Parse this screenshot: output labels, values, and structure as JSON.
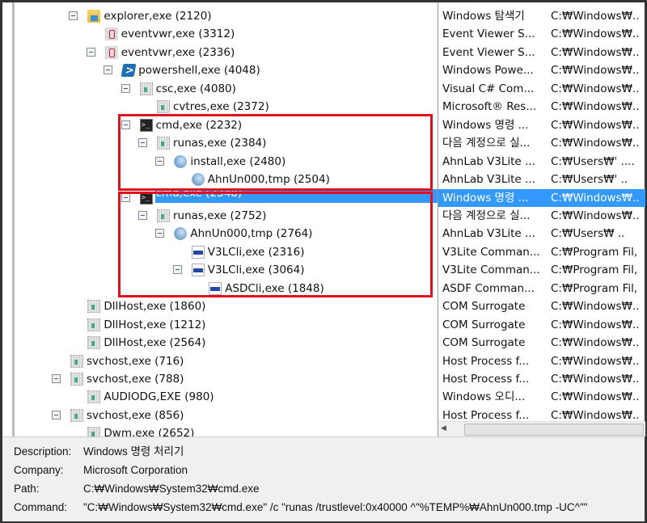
{
  "tree": [
    {
      "name": "explorer,exe (2120)",
      "depth": 1,
      "expand": true,
      "icon": "folder-icon",
      "desc": "Windows 탐색기",
      "path": "C:₩Windows₩.."
    },
    {
      "name": "eventvwr,exe (3312)",
      "depth": 2,
      "expand": false,
      "icon": "event-viewer-icon",
      "desc": "Event Viewer S...",
      "path": "C:₩Windows₩.."
    },
    {
      "name": "eventvwr,exe (2336)",
      "depth": 2,
      "expand": true,
      "icon": "event-viewer-icon",
      "desc": "Event Viewer S...",
      "path": "C:₩Windows₩.."
    },
    {
      "name": "powershell,exe (4048)",
      "depth": 3,
      "expand": true,
      "icon": "powershell-icon",
      "desc": "Windows Powe...",
      "path": "C:₩Windows₩.."
    },
    {
      "name": "csc,exe (4080)",
      "depth": 4,
      "expand": true,
      "icon": "generic-exe-icon",
      "desc": "Visual C# Com...",
      "path": "C:₩Windows₩.."
    },
    {
      "name": "cvtres,exe (2372)",
      "depth": 5,
      "expand": false,
      "icon": "generic-exe-icon",
      "desc": "Microsoft® Res...",
      "path": "C:₩Windows₩.."
    },
    {
      "name": "cmd,exe (2232)",
      "depth": 4,
      "expand": true,
      "icon": "cmd-icon",
      "desc": "Windows 명령 ...",
      "path": "C:₩Windows₩.."
    },
    {
      "name": "runas,exe (2384)",
      "depth": 5,
      "expand": true,
      "icon": "generic-exe-icon",
      "desc": "다음 계정으로 실...",
      "path": "C:₩Windows₩.."
    },
    {
      "name": "install,exe (2480)",
      "depth": 6,
      "expand": true,
      "icon": "installer-icon",
      "desc": "AhnLab V3Lite ...",
      "path": "C:₩Users₩'  ...."
    },
    {
      "name": "AhnUn000,tmp (2504)",
      "depth": 7,
      "expand": false,
      "icon": "installer-icon",
      "desc": "AhnLab V3Lite ...",
      "path": "C:₩Users₩'   .."
    },
    {
      "name": "cmd,exe (2348)",
      "depth": 4,
      "expand": true,
      "icon": "cmd-icon",
      "desc": "Windows 명령 ...",
      "path": "C:₩Windows₩..",
      "selected": true
    },
    {
      "name": "runas,exe (2752)",
      "depth": 5,
      "expand": true,
      "icon": "generic-exe-icon",
      "desc": "다음 계정으로 실...",
      "path": "C:₩Windows₩.."
    },
    {
      "name": "AhnUn000,tmp (2764)",
      "depth": 6,
      "expand": true,
      "icon": "installer-icon",
      "desc": "AhnLab V3Lite ...",
      "path": "C:₩Users₩    .."
    },
    {
      "name": "V3LCli,exe (2316)",
      "depth": 7,
      "expand": false,
      "icon": "v3-icon",
      "desc": "V3Lite Comman...",
      "path": "C:₩Program Fil,"
    },
    {
      "name": "V3LCli,exe (3064)",
      "depth": 7,
      "expand": true,
      "icon": "v3-icon",
      "desc": "V3Lite Comman...",
      "path": "C:₩Program Fil,"
    },
    {
      "name": "ASDCli,exe (1848)",
      "depth": 8,
      "expand": false,
      "icon": "v3-icon",
      "desc": "ASDF Comman...",
      "path": "C:₩Program Fil,"
    },
    {
      "name": "DllHost,exe (1860)",
      "depth": 1,
      "expand": false,
      "icon": "generic-exe-icon",
      "desc": "COM Surrogate",
      "path": "C:₩Windows₩.."
    },
    {
      "name": "DllHost,exe (1212)",
      "depth": 1,
      "expand": false,
      "icon": "generic-exe-icon",
      "desc": "COM Surrogate",
      "path": "C:₩Windows₩.."
    },
    {
      "name": "DllHost,exe (2564)",
      "depth": 1,
      "expand": false,
      "icon": "generic-exe-icon",
      "desc": "COM Surrogate",
      "path": "C:₩Windows₩.."
    },
    {
      "name": "svchost,exe (716)",
      "depth": 0,
      "expand": false,
      "icon": "generic-exe-icon",
      "desc": "Host Process f...",
      "path": "C:₩Windows₩.."
    },
    {
      "name": "svchost,exe (788)",
      "depth": 0,
      "expand": true,
      "icon": "generic-exe-icon",
      "desc": "Host Process f...",
      "path": "C:₩Windows₩.."
    },
    {
      "name": "AUDIODG,EXE (980)",
      "depth": 1,
      "expand": false,
      "icon": "generic-exe-icon",
      "desc": "Windows 오디...",
      "path": "C:₩Windows₩.."
    },
    {
      "name": "svchost,exe (856)",
      "depth": 0,
      "expand": true,
      "icon": "generic-exe-icon",
      "desc": "Host Process f...",
      "path": "C:₩Windows₩.."
    },
    {
      "name": "Dwm,exe (2652)",
      "depth": 1,
      "expand": false,
      "icon": "generic-exe-icon",
      "desc": "",
      "path": ""
    }
  ],
  "details": {
    "description_label": "Description:",
    "description": "Windows 명령 처리기",
    "company_label": "Company:",
    "company": "Microsoft Corporation",
    "path_label": "Path:",
    "path": "C:₩Windows₩System32₩cmd.exe",
    "command_label": "Command:",
    "command": "\"C:₩Windows₩System32₩cmd.exe\" /c \"runas /trustlevel:0x40000 ^\"%TEMP%₩AhnUn000.tmp -UC^\"\""
  },
  "colors": {
    "selection": "#3399ff",
    "highlight_box": "#e01020"
  }
}
